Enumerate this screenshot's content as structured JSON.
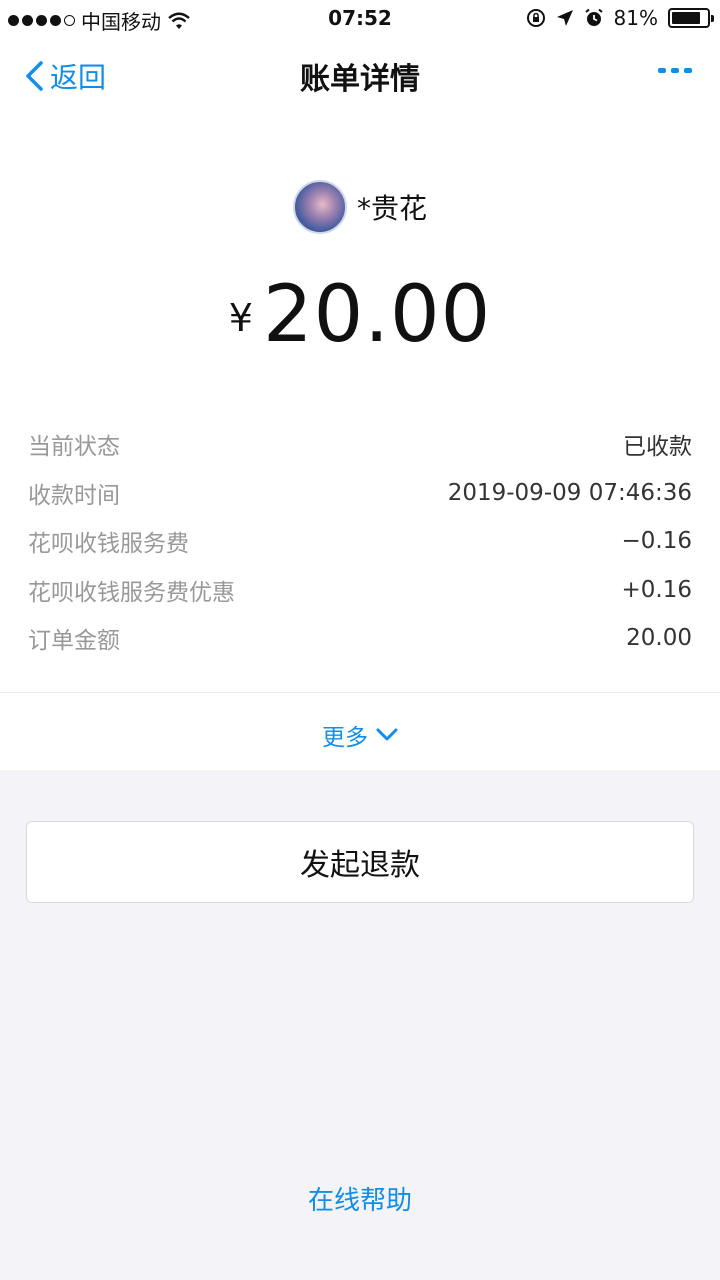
{
  "status_bar": {
    "carrier": "中国移动",
    "time": "07:52",
    "battery_percent": "81%",
    "battery_level": 0.81,
    "icons": [
      "signal-dots-icon",
      "wifi-icon",
      "rotation-lock-icon",
      "location-icon",
      "alarm-icon",
      "battery-icon"
    ]
  },
  "nav": {
    "back_label": "返回",
    "title": "账单详情",
    "more_icon": "more-dots-icon"
  },
  "payer": {
    "name": "*贵花"
  },
  "amount": {
    "symbol": "¥",
    "value": "20.00"
  },
  "details": [
    {
      "label": "当前状态",
      "value": "已收款"
    },
    {
      "label": "收款时间",
      "value": "2019-09-09 07:46:36"
    },
    {
      "label": "花呗收钱服务费",
      "value": "−0.16"
    },
    {
      "label": "花呗收钱服务费优惠",
      "value": "+0.16"
    },
    {
      "label": "订单金额",
      "value": "20.00"
    }
  ],
  "more_label": "更多",
  "refund_button": "发起退款",
  "help_link": "在线帮助",
  "colors": {
    "accent": "#108ee9",
    "background": "#f4f3f8",
    "label_gray": "#999999"
  }
}
